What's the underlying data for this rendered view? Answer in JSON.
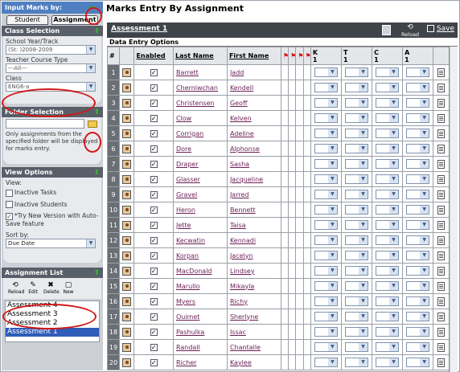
{
  "left_panel": {
    "input_marks_by": "Input Marks by:",
    "tabs": [
      "Student",
      "Assignment"
    ],
    "class_selection": {
      "title": "Class Selection",
      "school_year_label": "School Year/Track",
      "school_year_value": "(St: )2008-2009",
      "teacher_course_type_label": "Teacher Course Type",
      "teacher_course_type_value": "---All---",
      "class_label": "Class",
      "class_value": "ENG6-a"
    },
    "folder_selection": {
      "title": "Folder Selection",
      "help_text": "Only assignments from the specified folder will be displayed for marks entry."
    },
    "view_options": {
      "title": "View Options",
      "view_label": "View:",
      "inactive_tasks": "Inactive Tasks",
      "inactive_students": "Inactive Students",
      "try_new_version": "*Try New Version with Auto-Save feature",
      "sort_by_label": "Sort by:",
      "sort_by_value": "Due Date"
    },
    "assignment_list": {
      "title": "Assignment List",
      "buttons": [
        "Reload",
        "Edit",
        "Delete",
        "New"
      ],
      "items": [
        "Assessment 4",
        "Assessment 3",
        "Assessment 2",
        "Assessment 1"
      ],
      "selected": "Assessment 1"
    }
  },
  "main": {
    "title": "Marks Entry By Assignment",
    "assessment": "Assessment 1",
    "toolbar": {
      "reload": "Reload",
      "save": "Save"
    },
    "data_entry_options": "Data Entry Options",
    "columns": {
      "num": "#",
      "enabled": "Enabled",
      "last_name": "Last Name",
      "first_name": "First Name",
      "k": "K",
      "k_num": "1",
      "t": "T",
      "t_num": "1",
      "c": "C",
      "c_num": "1",
      "a": "A",
      "a_num": "1"
    },
    "rows": [
      {
        "n": "1",
        "last": "Barrett",
        "first": "Jadd"
      },
      {
        "n": "2",
        "last": "Cherniwchan",
        "first": "Kendell"
      },
      {
        "n": "3",
        "last": "Christensen",
        "first": "Geoff"
      },
      {
        "n": "4",
        "last": "Clow",
        "first": "Kelven"
      },
      {
        "n": "5",
        "last": "Corrigan",
        "first": "Adeline"
      },
      {
        "n": "6",
        "last": "Dore",
        "first": "Alphonse"
      },
      {
        "n": "7",
        "last": "Draper",
        "first": "Sasha"
      },
      {
        "n": "8",
        "last": "Glasser",
        "first": "Jacqueline"
      },
      {
        "n": "9",
        "last": "Gravel",
        "first": "Jarred"
      },
      {
        "n": "10",
        "last": "Heron",
        "first": "Bennett"
      },
      {
        "n": "11",
        "last": "Jette",
        "first": "Taisa"
      },
      {
        "n": "12",
        "last": "Kecwatin",
        "first": "Kennadi"
      },
      {
        "n": "13",
        "last": "Korpan",
        "first": "Jacelyn"
      },
      {
        "n": "14",
        "last": "MacDonald",
        "first": "Lindsey"
      },
      {
        "n": "15",
        "last": "Marullo",
        "first": "Mikayla"
      },
      {
        "n": "16",
        "last": "Myers",
        "first": "Richy"
      },
      {
        "n": "17",
        "last": "Ouimet",
        "first": "Sherlyne"
      },
      {
        "n": "18",
        "last": "Pashulka",
        "first": "Issac"
      },
      {
        "n": "19",
        "last": "Randall",
        "first": "Chantalle"
      },
      {
        "n": "20",
        "last": "Richer",
        "first": "Kaylee"
      }
    ]
  }
}
